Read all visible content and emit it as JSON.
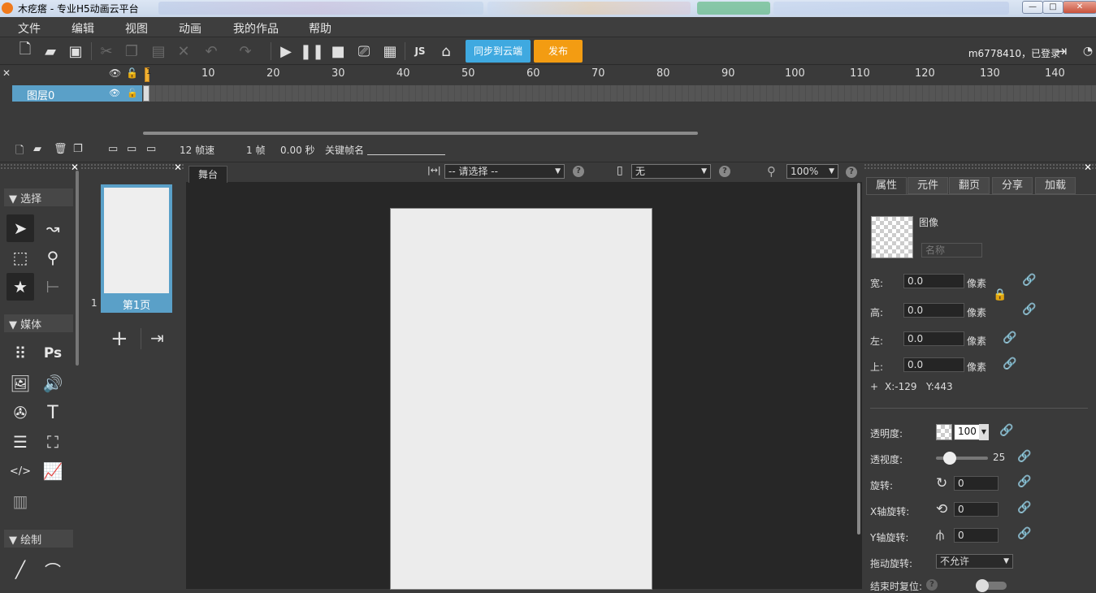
{
  "window": {
    "title": "木疙瘩 - 专业H5动画云平台",
    "min": "—",
    "max": "□",
    "close": "✕"
  },
  "menu": [
    "文件",
    "编辑",
    "视图",
    "动画",
    "我的作品",
    "帮助"
  ],
  "toolbar": {
    "sync_label": "同步到云端",
    "publish_label": "发布",
    "user": "m6778410，已登录"
  },
  "timeline": {
    "ticks": [
      "1",
      "10",
      "20",
      "30",
      "40",
      "50",
      "60",
      "70",
      "80",
      "90",
      "100",
      "110",
      "120",
      "130",
      "140"
    ],
    "layer_name": "图层0",
    "fps": "12 帧速",
    "frame": "1 帧",
    "time": "0.00 秒",
    "keyframe_label": "关键帧名"
  },
  "left_panel": {
    "section_select": "选择",
    "section_media": "媒体",
    "section_draw": "绘制"
  },
  "pages": {
    "page_number": "1",
    "page_label": "第1页"
  },
  "stage": {
    "tab": "舞台",
    "align_select": "-- 请选择 --",
    "device_select": "无",
    "zoom": "100%"
  },
  "props": {
    "tabs": [
      "属性",
      "元件",
      "翻页",
      "分享",
      "加载"
    ],
    "object_type": "图像",
    "name_placeholder": "名称",
    "unit": "像素",
    "width_label": "宽:",
    "width": "0.0",
    "height_label": "高:",
    "height": "0.0",
    "left_label": "左:",
    "left": "0.0",
    "top_label": "上:",
    "top": "0.0",
    "coord_prefix": "+",
    "coord_x": "X:-129",
    "coord_y": "Y:443",
    "opacity_label": "透明度:",
    "opacity": "100",
    "perspective_label": "透视度:",
    "perspective": "25",
    "perspective_level": 0.2,
    "rotate_label": "旋转:",
    "rotate": "0",
    "xrot_label": "X轴旋转:",
    "xrot": "0",
    "yrot_label": "Y轴旋转:",
    "yrot": "0",
    "drag_label": "拖动旋转:",
    "drag": "不允许",
    "reset_label": "结束时复位:"
  }
}
